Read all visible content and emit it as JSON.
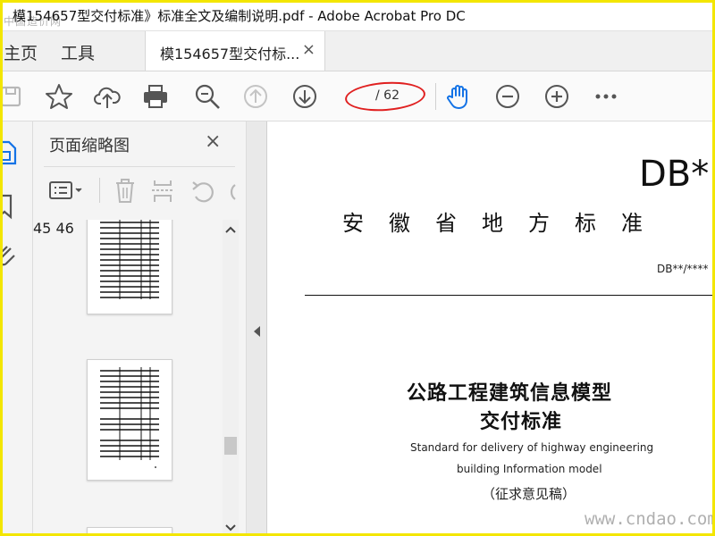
{
  "window": {
    "title": "模154657型交付标准》标准全文及编制说明.pdf - Adobe Acrobat Pro DC",
    "watermark_top": "中国造价网"
  },
  "tabs": {
    "home": "主页",
    "tools": "工具",
    "document": "模154657型交付标...",
    "close_symbol": "×"
  },
  "toolbar": {
    "page_current": "",
    "page_total": "/ 62",
    "icons": [
      "save-icon",
      "star-icon",
      "cloud-upload-icon",
      "print-icon",
      "zoom-search-icon",
      "page-up-icon",
      "page-down-icon",
      "hand-icon",
      "zoom-out-icon",
      "zoom-in-icon",
      "more-icon"
    ]
  },
  "panel": {
    "title": "页面缩略图",
    "close_symbol": "×",
    "thumbs": [
      {
        "label": "45"
      },
      {
        "label": "46"
      }
    ]
  },
  "document": {
    "code_top": "DB*",
    "province": "安徽省地方标准",
    "code_number": "DB**/****",
    "title_line1": "公路工程建筑信息模型",
    "title_line2": "交付标准",
    "english_line1": "Standard for delivery of highway engineering",
    "english_line2": "building Information model",
    "draft_note": "（征求意见稿）"
  },
  "watermark_bottom": "www.cndao.com",
  "colors": {
    "accent_blue": "#1473e6",
    "annotation_red": "#e02020",
    "frame_yellow": "#f3e600"
  }
}
